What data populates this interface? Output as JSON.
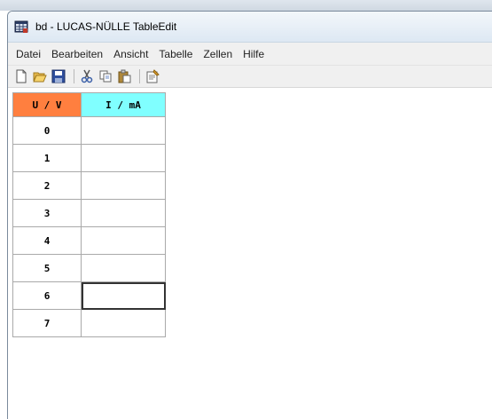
{
  "window": {
    "title": "bd - LUCAS-NÜLLE TableEdit",
    "icon": "table-edit-app-icon"
  },
  "menu": {
    "items": [
      "Datei",
      "Bearbeiten",
      "Ansicht",
      "Tabelle",
      "Zellen",
      "Hilfe"
    ]
  },
  "toolbar": {
    "buttons": [
      "new-document-icon",
      "open-folder-icon",
      "save-icon",
      "cut-icon",
      "copy-icon",
      "paste-icon",
      "properties-icon"
    ]
  },
  "table": {
    "headers": [
      "U / V",
      "I / mA"
    ],
    "header_colors": [
      "#ff7f3f",
      "#80ffff"
    ],
    "rows": [
      {
        "u": "0",
        "i": ""
      },
      {
        "u": "1",
        "i": ""
      },
      {
        "u": "2",
        "i": ""
      },
      {
        "u": "3",
        "i": ""
      },
      {
        "u": "4",
        "i": ""
      },
      {
        "u": "5",
        "i": ""
      },
      {
        "u": "6",
        "i": ""
      },
      {
        "u": "7",
        "i": ""
      }
    ],
    "selected_row": 6
  }
}
